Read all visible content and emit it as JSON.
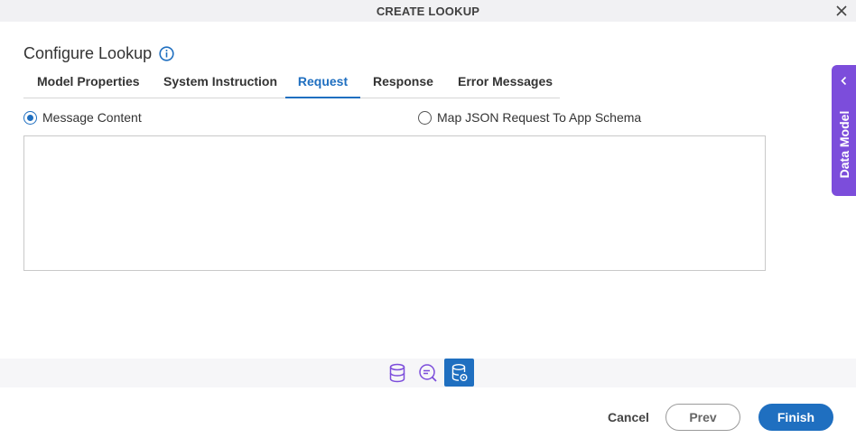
{
  "dialog": {
    "title": "CREATE LOOKUP"
  },
  "heading": {
    "text": "Configure Lookup"
  },
  "tabs": [
    {
      "label": "Model Properties"
    },
    {
      "label": "System Instruction"
    },
    {
      "label": "Request",
      "active": true
    },
    {
      "label": "Response"
    },
    {
      "label": "Error Messages"
    }
  ],
  "request": {
    "options": [
      {
        "label": "Message Content",
        "checked": true
      },
      {
        "label": "Map JSON Request To App Schema",
        "checked": false
      }
    ],
    "message_value": ""
  },
  "side_panel": {
    "label": "Data Model"
  },
  "toolbar": {
    "icons": [
      "database-icon",
      "chat-search-icon",
      "database-settings-icon"
    ],
    "active_index": 2
  },
  "footer": {
    "cancel_label": "Cancel",
    "prev_label": "Prev",
    "finish_label": "Finish"
  },
  "colors": {
    "accent": "#1f6fc0",
    "side_panel": "#7c4ddb",
    "tool_purple": "#7c4ddb"
  }
}
